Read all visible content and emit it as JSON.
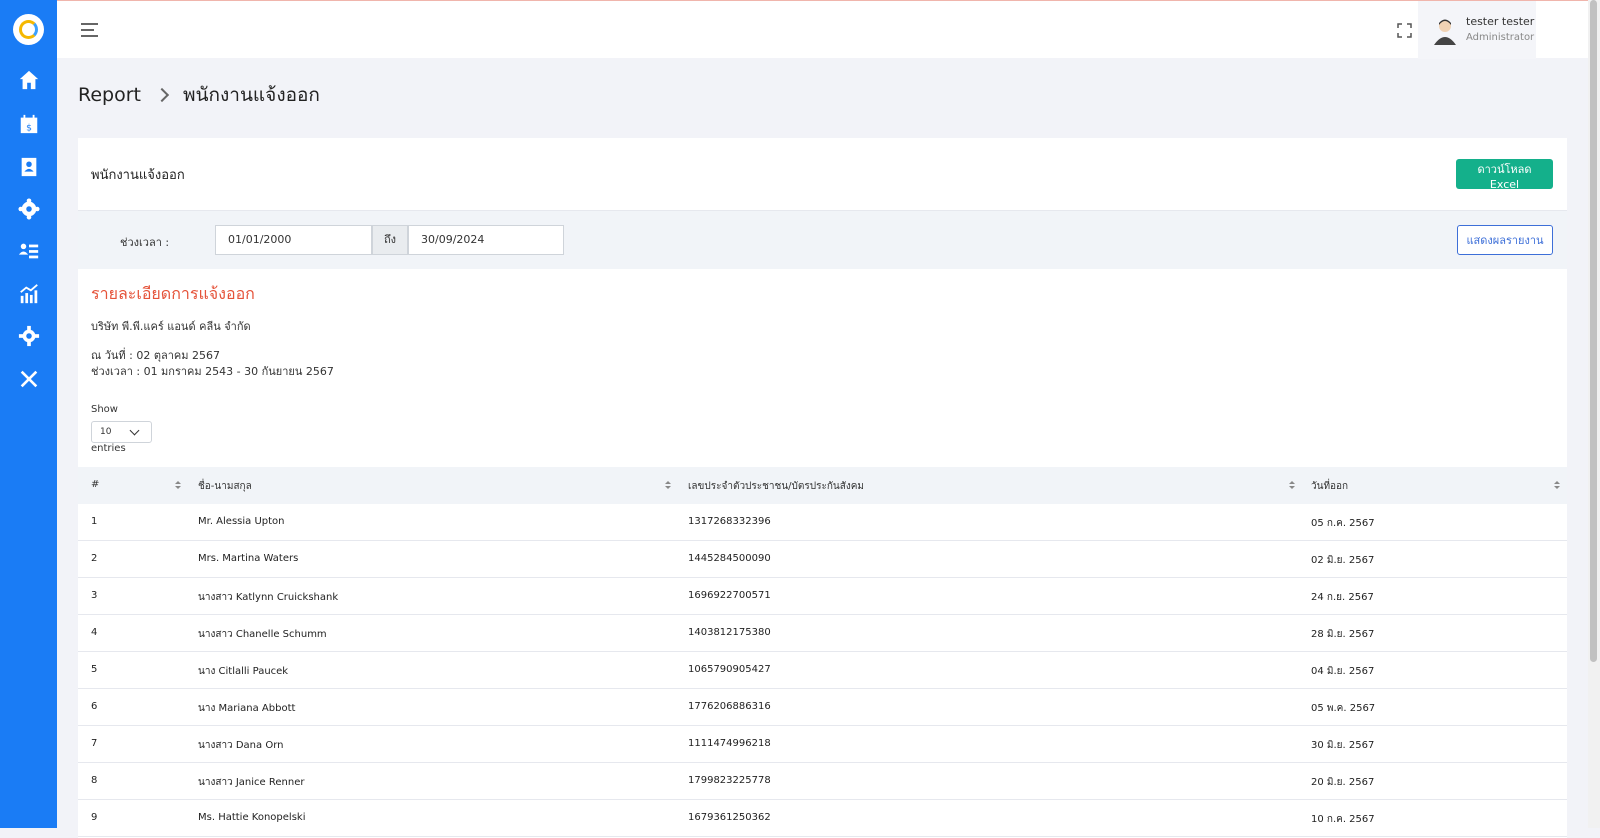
{
  "topbar": {
    "user_name": "tester tester",
    "user_role": "Administrator"
  },
  "breadcrumb": {
    "root": "Report",
    "current": "พนักงานแจ้งออก"
  },
  "card": {
    "title": "พนักงานแจ้งออก",
    "excel_button": "ดาวน์โหลด Excel"
  },
  "filter": {
    "label": "ช่วงเวลา :",
    "from": "01/01/2000",
    "to_label": "ถึง",
    "to": "30/09/2024",
    "show_button": "แสดงผลรายงาน"
  },
  "report": {
    "title": "รายละเอียดการแจ้งออก",
    "company": "บริษัท พี.พี.แคร์ แอนด์ คลีน จำกัด",
    "as_of": "ณ วันที่ : 02 ตุลาคม 2567",
    "period": "ช่วงเวลา : 01 มกราคม 2543 - 30 กันยายน 2567"
  },
  "entries": {
    "show_label": "Show",
    "value": "10",
    "entries_label": "entries"
  },
  "table": {
    "headers": [
      "#",
      "ชื่อ-นามสกุล",
      "เลขประจำตัวประชาชน/บัตรประกันสังคม",
      "วันที่ออก"
    ],
    "rows": [
      [
        "1",
        "Mr. Alessia Upton",
        "1317268332396",
        "05 ก.ค. 2567"
      ],
      [
        "2",
        "Mrs. Martina Waters",
        "1445284500090",
        "02 มิ.ย. 2567"
      ],
      [
        "3",
        "นางสาว Katlynn Cruickshank",
        "1696922700571",
        "24 ก.ย. 2567"
      ],
      [
        "4",
        "นางสาว Chanelle Schumm",
        "1403812175380",
        "28 มิ.ย. 2567"
      ],
      [
        "5",
        "นาง Citlalli Paucek",
        "1065790905427",
        "04 มิ.ย. 2567"
      ],
      [
        "6",
        "นาง Mariana Abbott",
        "1776206886316",
        "05 พ.ค. 2567"
      ],
      [
        "7",
        "นางสาว Dana Orn",
        "1111474996218",
        "30 มิ.ย. 2567"
      ],
      [
        "8",
        "นางสาว Janice Renner",
        "1799823225778",
        "20 มิ.ย. 2567"
      ],
      [
        "9",
        "Ms. Hattie Konopelski",
        "1679361250362",
        "10 ก.ค. 2567"
      ]
    ]
  },
  "colors": {
    "sidebar": "#1a7cf5",
    "accent_green": "#14b08b",
    "accent_blue": "#3d6fd8",
    "title_red": "#e5533a"
  },
  "icons": [
    "home-icon",
    "calendar-dollar-icon",
    "contact-book-icon",
    "users-cog-icon",
    "user-list-icon",
    "chart-icon",
    "gear-icon",
    "tools-icon"
  ]
}
